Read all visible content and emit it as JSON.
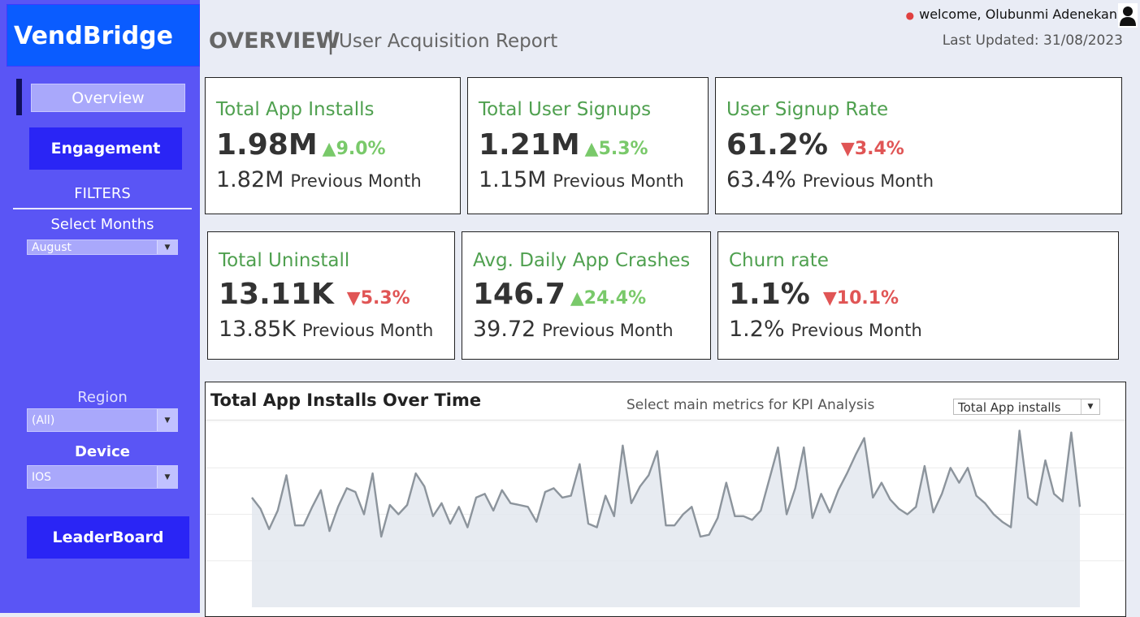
{
  "app": {
    "name": "VendBridge"
  },
  "nav": {
    "overview": "Overview",
    "engagement": "Engagement",
    "leaderboard": "LeaderBoard"
  },
  "filters": {
    "title": "FILTERS",
    "months_label": "Select Months",
    "months_value": "August",
    "region_label": "Region",
    "region_value": "(All)",
    "device_label": "Device",
    "device_value": "IOS"
  },
  "header": {
    "title": "OVERVIEW",
    "separator": "|",
    "subtitle": "User Acquisition Report",
    "welcome": "welcome, Olubunmi Adenekan",
    "last_updated": "Last Updated: 31/08/2023"
  },
  "kpis": [
    {
      "title": "Total App Installs",
      "value": "1.98M",
      "change": "▲9.0%",
      "direction": "up",
      "previous": "1.82M",
      "previous_label": "Previous Month"
    },
    {
      "title": "Total User Signups",
      "value": "1.21M",
      "change": "▲5.3%",
      "direction": "up",
      "previous": "1.15M",
      "previous_label": "Previous Month"
    },
    {
      "title": "User Signup Rate",
      "value": "61.2%",
      "change": "▼3.4%",
      "direction": "down",
      "previous": "63.4%",
      "previous_label": "Previous Month"
    },
    {
      "title": "Total Uninstall",
      "value": "13.11K",
      "change": "▼5.3%",
      "direction": "down",
      "previous": "13.85K",
      "previous_label": "Previous Month"
    },
    {
      "title": "Avg. Daily App Crashes",
      "value": "146.7",
      "change": "▲24.4%",
      "direction": "up",
      "previous": "39.72",
      "previous_label": "Previous Month"
    },
    {
      "title": "Churn rate",
      "value": "1.1%",
      "change": "▼10.1%",
      "direction": "down",
      "previous": "1.2%",
      "previous_label": "Previous Month"
    }
  ],
  "chart_section": {
    "title": "Total App Installs Over Time",
    "select_label": "Select  main metrics for KPI Analysis",
    "select_value": "Total App installs"
  },
  "chart_data": {
    "type": "area",
    "title": "Total App Installs Over Time",
    "grid": true,
    "ylim": [
      0,
      100
    ],
    "values": [
      59,
      53,
      42,
      52,
      71,
      44,
      44,
      54,
      63,
      41,
      54,
      64,
      62,
      50,
      72,
      38,
      55,
      50,
      55,
      72,
      65,
      49,
      56,
      45,
      54,
      43,
      59,
      61,
      52,
      63,
      56,
      55,
      54,
      46,
      62,
      64,
      59,
      60,
      77,
      45,
      43,
      60,
      49,
      87,
      56,
      65,
      71,
      84,
      44,
      44,
      50,
      54,
      38,
      39,
      48,
      67,
      49,
      49,
      47,
      52,
      69,
      86,
      50,
      64,
      86,
      48,
      61,
      51,
      63,
      72,
      82,
      91,
      59,
      67,
      58,
      53,
      50,
      54,
      76,
      51,
      61,
      75,
      67,
      75,
      60,
      56,
      50,
      46,
      43,
      95,
      59,
      55,
      79,
      61,
      57,
      94,
      54
    ]
  },
  "colors": {
    "sidebar": "#5a55f5",
    "logo_bg": "#0a5cff",
    "button": "#2a25f5",
    "kpi_title": "#4fa04f",
    "up": "#79c96a",
    "down": "#e05555",
    "line": "#8c949c",
    "area": "#e3e8ee"
  }
}
